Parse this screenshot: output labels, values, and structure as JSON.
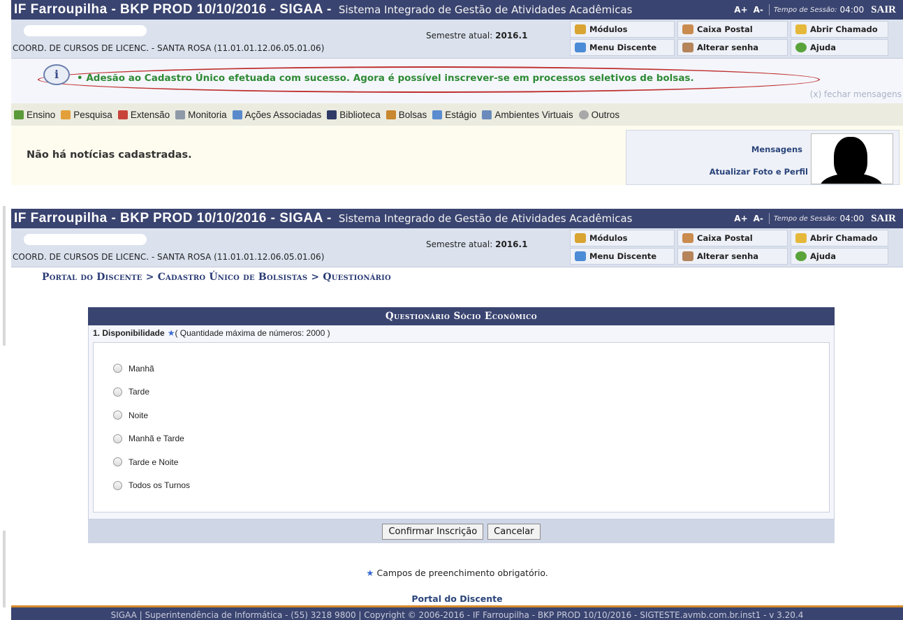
{
  "header": {
    "system": "IF Farroupilha - BKP PROD 10/10/2016 - SIGAA -",
    "subtitle": "Sistema Integrado de Gestão de Atividades Acadêmicas",
    "font_plus": "A+",
    "font_minus": "A-",
    "session_label": "Tempo de Sessão:",
    "session_time": "04:00",
    "logout": "SAIR"
  },
  "info": {
    "unit": "COORD. DE CURSOS DE LICENC. - SANTA ROSA (11.01.01.12.06.05.01.06)",
    "semester_label": "Semestre atual:",
    "semester_value": "2016.1"
  },
  "modules": {
    "modulos": "Módulos",
    "caixa_postal": "Caixa Postal",
    "abrir_chamado": "Abrir Chamado",
    "menu_discente": "Menu Discente",
    "alterar_senha": "Alterar senha",
    "ajuda": "Ajuda"
  },
  "message": {
    "text": "• Adesão ao Cadastro Único efetuada com sucesso. Agora é possível inscrever-se em processos seletivos de bolsas.",
    "close": "(x) fechar mensagens"
  },
  "menu": {
    "ensino": "Ensino",
    "pesquisa": "Pesquisa",
    "extensao": "Extensão",
    "monitoria": "Monitoria",
    "acoes": "Ações Associadas",
    "biblioteca": "Biblioteca",
    "bolsas": "Bolsas",
    "estagio": "Estágio",
    "ambientes": "Ambientes Virtuais",
    "outros": "Outros"
  },
  "news": {
    "empty": "Não há notícias cadastradas.",
    "mensagens": "Mensagens",
    "atualizar": "Atualizar Foto e Perfil"
  },
  "breadcrumb": "Portal do Discente > Cadastro Único de Bolsistas > Questionário",
  "form": {
    "caption": "Questionário Sócio Econômico",
    "question_number": "1. Disponibilidade",
    "question_note": "( Quantidade máxima de números: 2000 )",
    "options": {
      "o1": "Manhã",
      "o2": "Tarde",
      "o3": "Noite",
      "o4": "Manhã e Tarde",
      "o5": "Tarde e Noite",
      "o6": "Todos os Turnos"
    },
    "confirm": "Confirmar Inscrição",
    "cancel": "Cancelar"
  },
  "required_note": "Campos de preenchimento obrigatório.",
  "portal_link": "Portal do Discente",
  "footer": "SIGAA | Superintendência de Informática - (55) 3218 9800 | Copyright © 2006-2016 - IF Farroupilha - BKP PROD 10/10/2016 - SIGTESTE.avmb.com.br.inst1 - v 3.20.4",
  "colors": {
    "header_bg": "#3a4470",
    "success_text": "#2f8a35",
    "highlight_oval": "#c03030",
    "footer_accent": "#d98b2b"
  }
}
